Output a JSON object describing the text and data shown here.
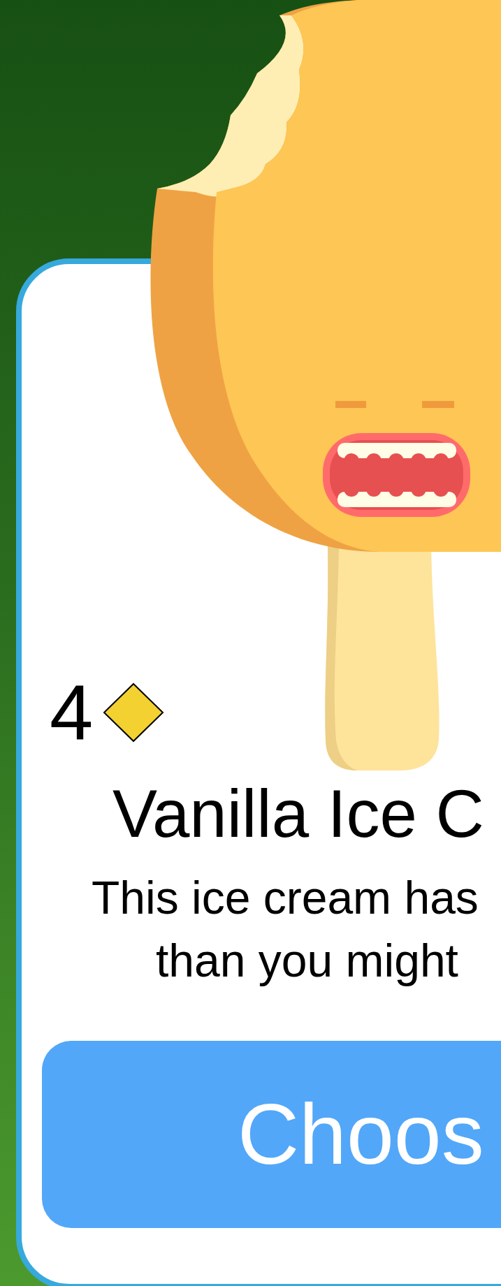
{
  "card": {
    "cost": "4",
    "title": "Vanilla Ice C",
    "description_lines": [
      "This ice cream has",
      "than you might"
    ],
    "button": "Choos"
  }
}
